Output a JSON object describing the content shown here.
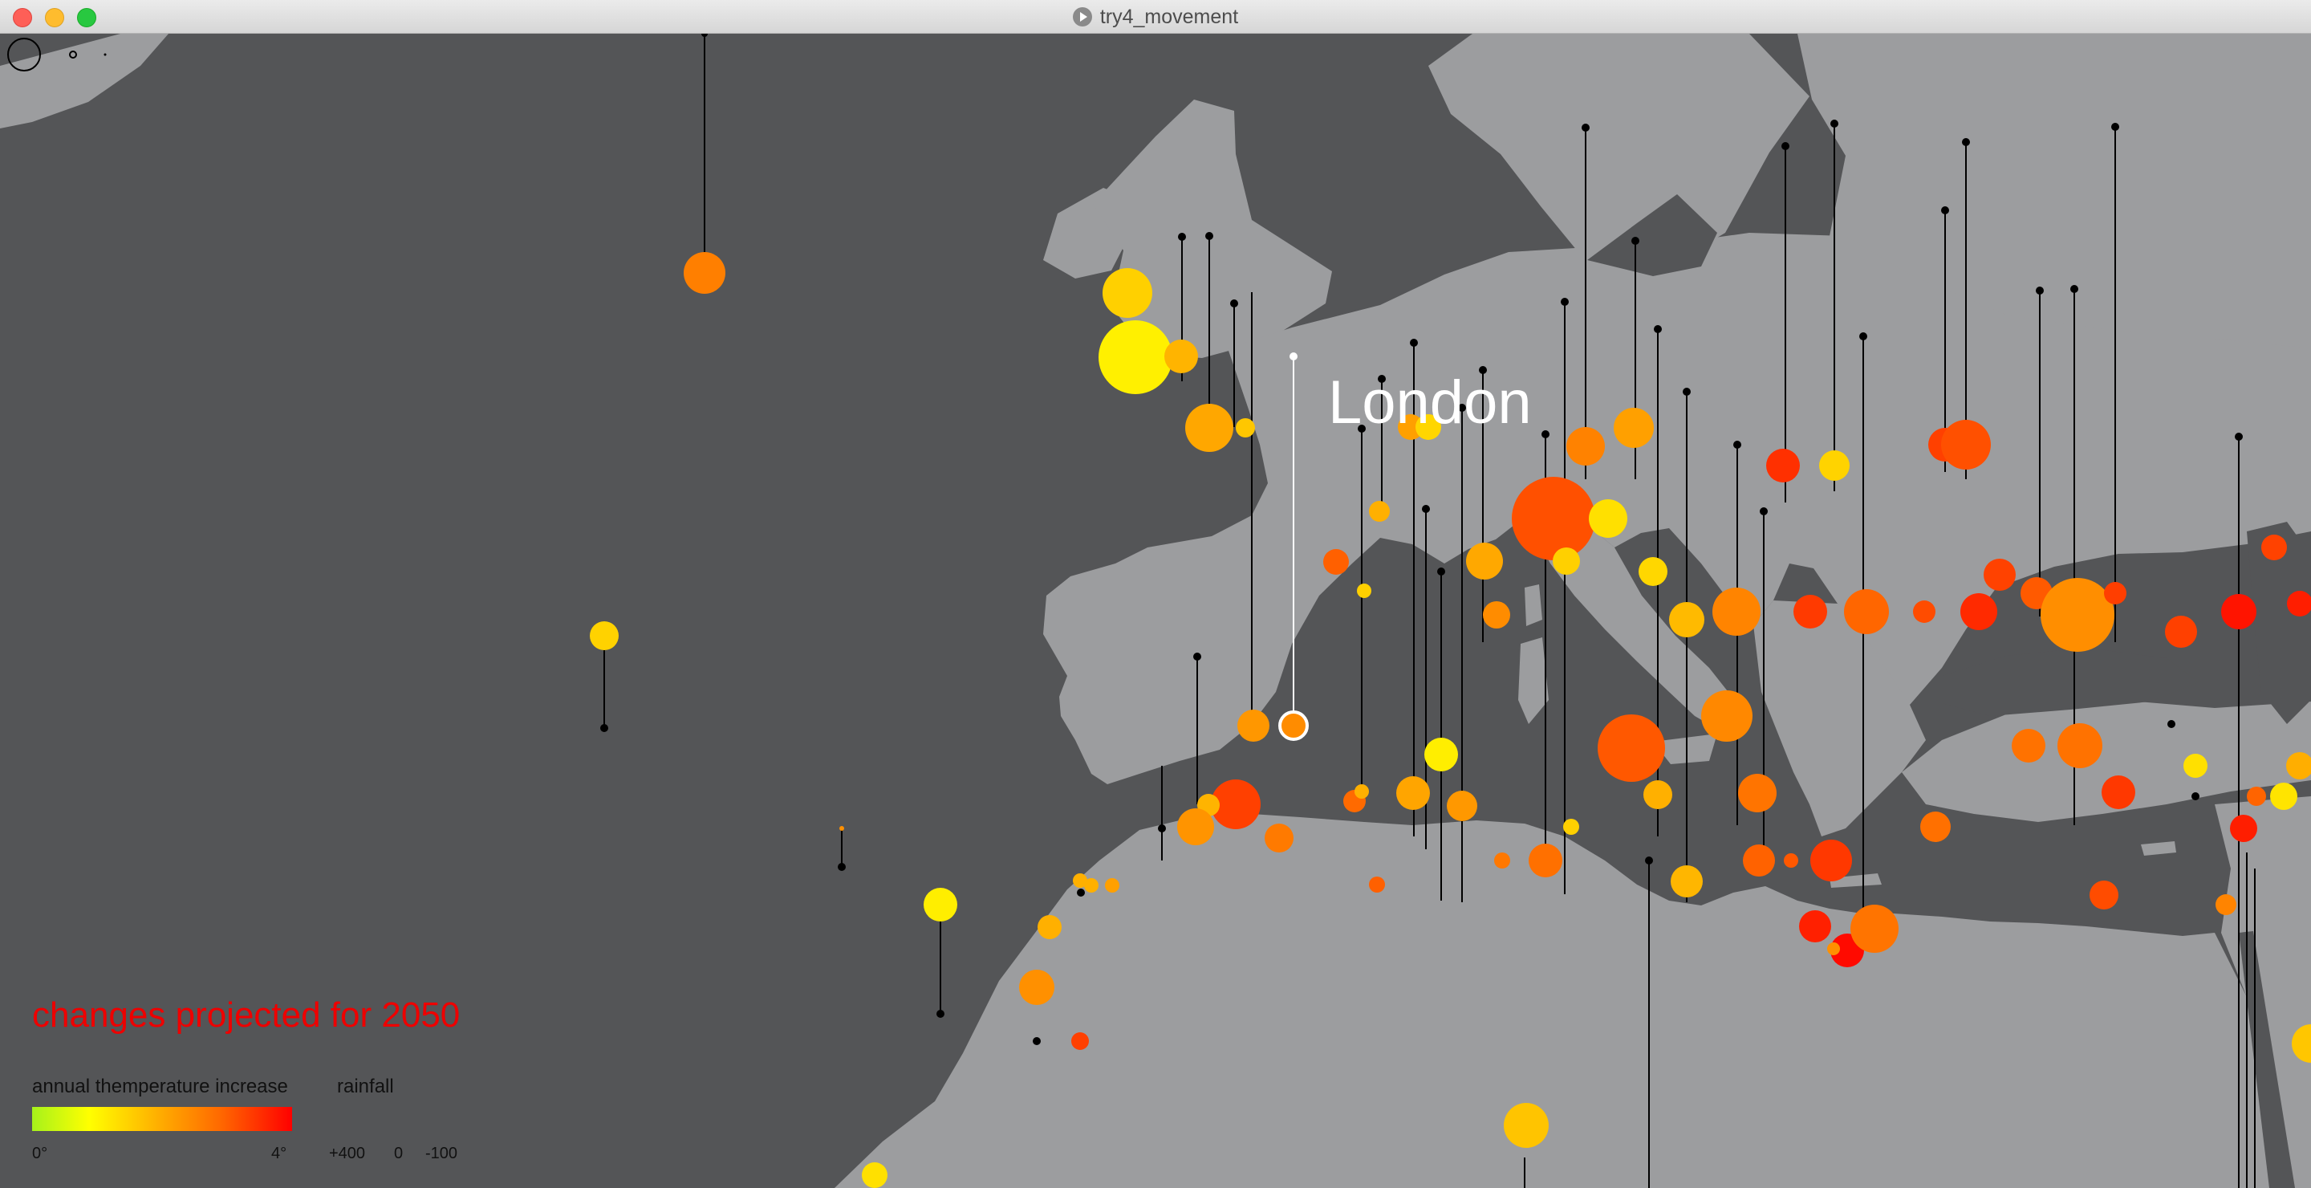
{
  "window": {
    "title": "try4_movement"
  },
  "map": {
    "background_color": "#545557",
    "land_color": "#9c9d9f",
    "highlight_city": "London"
  },
  "legend": {
    "title": "changes projected for 2050",
    "temperature": {
      "label": "annual themperature increase",
      "min_label": "0°",
      "max_label": "4°"
    },
    "rainfall": {
      "label": "rainfall",
      "values": [
        "+400",
        "0",
        "-100"
      ]
    }
  }
}
